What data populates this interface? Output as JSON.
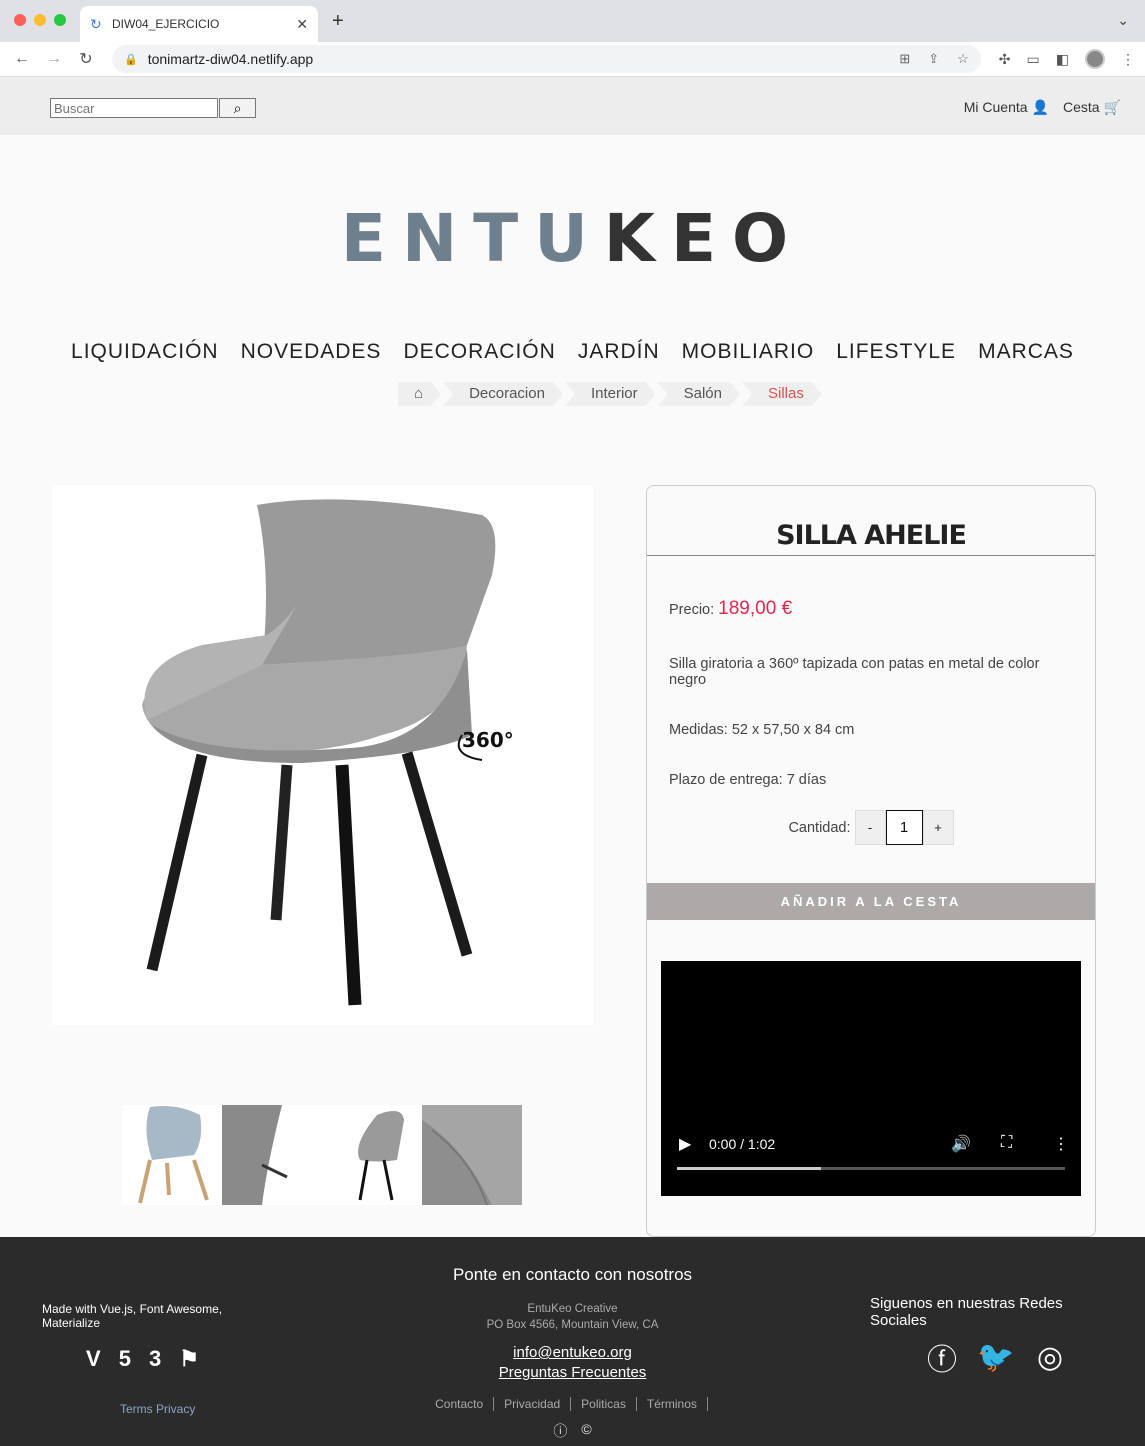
{
  "browser": {
    "tab_title": "DIW04_EJERCICIO",
    "url": "tonimartz-diw04.netlify.app"
  },
  "topbar": {
    "search_placeholder": "Buscar",
    "account_label": "Mi Cuenta",
    "cart_label": "Cesta"
  },
  "logo": {
    "part1": "ENTU",
    "part2": "KEO"
  },
  "menu": [
    "LIQUIDACIÓN",
    "NOVEDADES",
    "DECORACIÓN",
    "JARDÍN",
    "MOBILIARIO",
    "LIFESTYLE",
    "MARCAS"
  ],
  "breadcrumbs": [
    "Decoracion",
    "Interior",
    "Salón",
    "Sillas"
  ],
  "product": {
    "title": "SILLA AHELIE",
    "price_label": "Precio:",
    "price_value": "189,00 €",
    "description": "Silla giratoria a 360º tapizada con patas en metal de color negro",
    "dimensions": "Medidas: 52 x 57,50 x 84 cm",
    "delivery": "Plazo de entrega: 7 días",
    "quantity_label": "Cantidad:",
    "minus": "-",
    "quantity": "1",
    "plus": "+",
    "add_to_cart": "AÑADIR A LA CESTA",
    "badge": "360°"
  },
  "video": {
    "time": "0:00 / 1:02",
    "progress": 0.37
  },
  "footer": {
    "made_with": "Made with Vue.js, Font Awesome, Materialize",
    "terms": "Terms Privacy",
    "contact_title": "Ponte en contacto con nosotros",
    "company": "EntuKeo Creative",
    "address": "PO Box 4566, Mountain View, CA",
    "email": "info@entukeo.org",
    "faq": "Preguntas Frecuentes",
    "links": [
      "Contacto",
      "Privacidad",
      "Politicas",
      "Términos"
    ],
    "social_title": "Siguenos en nuestras Redes Sociales"
  }
}
